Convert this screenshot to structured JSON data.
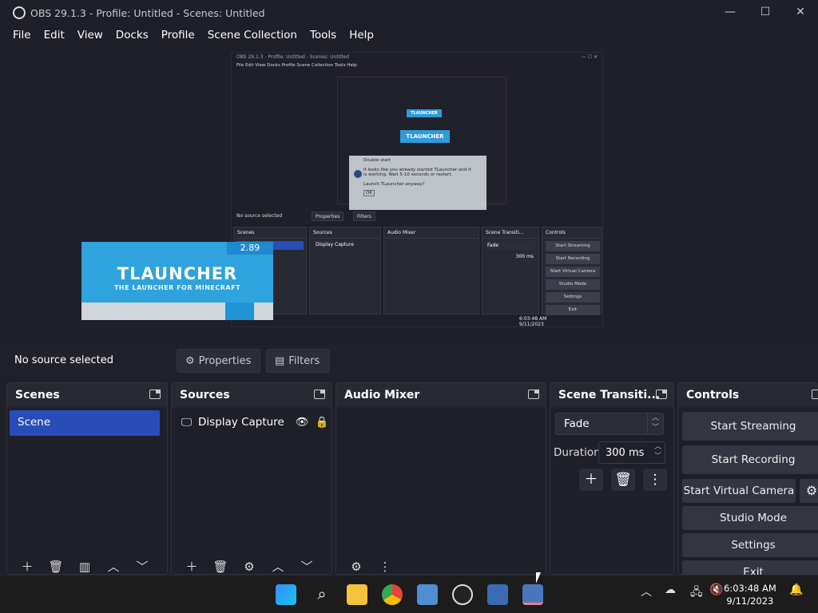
{
  "window": {
    "title": "OBS 29.1.3 - Profile: Untitled - Scenes: Untitled",
    "minimize": "—",
    "maximize": "☐",
    "close": "✕"
  },
  "menu": [
    "File",
    "Edit",
    "View",
    "Docks",
    "Profile",
    "Scene Collection",
    "Tools",
    "Help"
  ],
  "preview": {
    "thumb_title": "OBS 29.1.3 - Profile: Untitled - Scenes: Untitled",
    "thumb_menu": "File   Edit   View   Docks   Profile   Scene Collection   Tools   Help",
    "dialog_title": "Double start",
    "dialog_text": "It looks like you already started TLauncher and it is working. Wait 5-10 seconds or restart.",
    "dialog_question": "Launch TLauncher anyway?",
    "dialog_ok": "OK",
    "status": "No source selected",
    "properties": "Properties",
    "filters": "Filters",
    "docks": [
      "Scenes",
      "Sources",
      "Audio Mixer",
      "Scene Transiti...",
      "Controls"
    ],
    "scene": "Scene",
    "source": "Display Capture",
    "fade": "Fade",
    "duration": "300 ms",
    "controls": [
      "Start Streaming",
      "Start Recording",
      "Start Virtual Camera",
      "Studio Mode",
      "Settings",
      "Exit"
    ],
    "tlauncher_title": "TLAUNCHER",
    "tlauncher_sub": "THE LAUNCHER FOR MINECRAFT",
    "tlauncher_version": "2.89",
    "thumb_time": "6:03:48 AM",
    "thumb_date": "9/11/2023"
  },
  "status": {
    "no_source": "No source selected",
    "properties": "Properties",
    "filters": "Filters"
  },
  "scenes": {
    "title": "Scenes",
    "items": [
      "Scene"
    ]
  },
  "sources": {
    "title": "Sources",
    "items": [
      "Display Capture"
    ]
  },
  "audio": {
    "title": "Audio Mixer"
  },
  "transitions": {
    "title": "Scene Transiti...",
    "selected": "Fade",
    "duration_label": "Duration",
    "duration_value": "300 ms"
  },
  "controls": {
    "title": "Controls",
    "start_streaming": "Start Streaming",
    "start_recording": "Start Recording",
    "start_virtual_camera": "Start Virtual Camera",
    "studio_mode": "Studio Mode",
    "settings": "Settings",
    "exit": "Exit"
  },
  "taskbar": {
    "time": "6:03:48 AM",
    "date": "9/11/2023"
  }
}
